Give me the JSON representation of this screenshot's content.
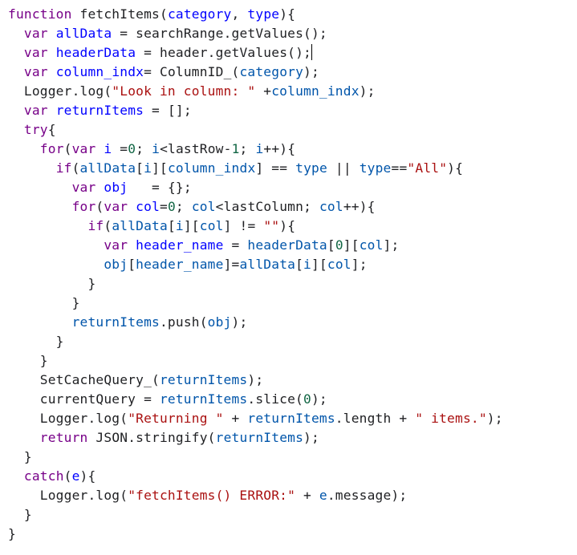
{
  "editor": {
    "language": "javascript",
    "cursor_line": 3,
    "colors": {
      "keyword": "#770088",
      "definition": "#0000ff",
      "variable": "#0055aa",
      "string": "#aa1111",
      "number": "#116644",
      "text": "#202124"
    },
    "lines": [
      [
        [
          "kw",
          "function"
        ],
        [
          "t",
          " fetchItems("
        ],
        [
          "def",
          "category"
        ],
        [
          "t",
          ", "
        ],
        [
          "def",
          "type"
        ],
        [
          "t",
          "){"
        ]
      ],
      [
        [
          "t",
          "  "
        ],
        [
          "kw",
          "var"
        ],
        [
          "t",
          " "
        ],
        [
          "def",
          "allData"
        ],
        [
          "t",
          " = searchRange.getValues();"
        ]
      ],
      [
        [
          "t",
          "  "
        ],
        [
          "kw",
          "var"
        ],
        [
          "t",
          " "
        ],
        [
          "def",
          "headerData"
        ],
        [
          "t",
          " = header.getValues();"
        ]
      ],
      [
        [
          "t",
          "  "
        ],
        [
          "kw",
          "var"
        ],
        [
          "t",
          " "
        ],
        [
          "def",
          "column_indx"
        ],
        [
          "t",
          "= ColumnID_("
        ],
        [
          "var",
          "category"
        ],
        [
          "t",
          ");"
        ]
      ],
      [
        [
          "t",
          "  Logger.log("
        ],
        [
          "str",
          "\"Look in column: \""
        ],
        [
          "t",
          " +"
        ],
        [
          "var",
          "column_indx"
        ],
        [
          "t",
          ");"
        ]
      ],
      [
        [
          "t",
          "  "
        ],
        [
          "kw",
          "var"
        ],
        [
          "t",
          " "
        ],
        [
          "def",
          "returnItems"
        ],
        [
          "t",
          " = [];"
        ]
      ],
      [
        [
          "t",
          "  "
        ],
        [
          "kw",
          "try"
        ],
        [
          "t",
          "{"
        ]
      ],
      [
        [
          "t",
          "    "
        ],
        [
          "kw",
          "for"
        ],
        [
          "t",
          "("
        ],
        [
          "kw",
          "var"
        ],
        [
          "t",
          " "
        ],
        [
          "def",
          "i"
        ],
        [
          "t",
          " ="
        ],
        [
          "num",
          "0"
        ],
        [
          "t",
          "; "
        ],
        [
          "var",
          "i"
        ],
        [
          "t",
          "<lastRow-"
        ],
        [
          "num",
          "1"
        ],
        [
          "t",
          "; "
        ],
        [
          "var",
          "i"
        ],
        [
          "t",
          "++){"
        ]
      ],
      [
        [
          "t",
          "      "
        ],
        [
          "kw",
          "if"
        ],
        [
          "t",
          "("
        ],
        [
          "var",
          "allData"
        ],
        [
          "t",
          "["
        ],
        [
          "var",
          "i"
        ],
        [
          "t",
          "]["
        ],
        [
          "var",
          "column_indx"
        ],
        [
          "t",
          "] == "
        ],
        [
          "var",
          "type"
        ],
        [
          "t",
          " || "
        ],
        [
          "var",
          "type"
        ],
        [
          "t",
          "=="
        ],
        [
          "str",
          "\"All\""
        ],
        [
          "t",
          "){"
        ]
      ],
      [
        [
          "t",
          "        "
        ],
        [
          "kw",
          "var"
        ],
        [
          "t",
          " "
        ],
        [
          "def",
          "obj"
        ],
        [
          "t",
          "   = {};"
        ]
      ],
      [
        [
          "t",
          "        "
        ],
        [
          "kw",
          "for"
        ],
        [
          "t",
          "("
        ],
        [
          "kw",
          "var"
        ],
        [
          "t",
          " "
        ],
        [
          "def",
          "col"
        ],
        [
          "t",
          "="
        ],
        [
          "num",
          "0"
        ],
        [
          "t",
          "; "
        ],
        [
          "var",
          "col"
        ],
        [
          "t",
          "<lastColumn; "
        ],
        [
          "var",
          "col"
        ],
        [
          "t",
          "++){"
        ]
      ],
      [
        [
          "t",
          "          "
        ],
        [
          "kw",
          "if"
        ],
        [
          "t",
          "("
        ],
        [
          "var",
          "allData"
        ],
        [
          "t",
          "["
        ],
        [
          "var",
          "i"
        ],
        [
          "t",
          "]["
        ],
        [
          "var",
          "col"
        ],
        [
          "t",
          "] != "
        ],
        [
          "str",
          "\"\""
        ],
        [
          "t",
          "){"
        ]
      ],
      [
        [
          "t",
          "            "
        ],
        [
          "kw",
          "var"
        ],
        [
          "t",
          " "
        ],
        [
          "def",
          "header_name"
        ],
        [
          "t",
          " = "
        ],
        [
          "var",
          "headerData"
        ],
        [
          "t",
          "["
        ],
        [
          "num",
          "0"
        ],
        [
          "t",
          "]["
        ],
        [
          "var",
          "col"
        ],
        [
          "t",
          "];"
        ]
      ],
      [
        [
          "t",
          "            "
        ],
        [
          "var",
          "obj"
        ],
        [
          "t",
          "["
        ],
        [
          "var",
          "header_name"
        ],
        [
          "t",
          "]="
        ],
        [
          "var",
          "allData"
        ],
        [
          "t",
          "["
        ],
        [
          "var",
          "i"
        ],
        [
          "t",
          "]["
        ],
        [
          "var",
          "col"
        ],
        [
          "t",
          "];"
        ]
      ],
      [
        [
          "t",
          "          }"
        ]
      ],
      [
        [
          "t",
          "        }"
        ]
      ],
      [
        [
          "t",
          "        "
        ],
        [
          "var",
          "returnItems"
        ],
        [
          "t",
          ".push("
        ],
        [
          "var",
          "obj"
        ],
        [
          "t",
          ");"
        ]
      ],
      [
        [
          "t",
          "      }"
        ]
      ],
      [
        [
          "t",
          "    }"
        ]
      ],
      [
        [
          "t",
          "    SetCacheQuery_("
        ],
        [
          "var",
          "returnItems"
        ],
        [
          "t",
          ");"
        ]
      ],
      [
        [
          "t",
          "    currentQuery = "
        ],
        [
          "var",
          "returnItems"
        ],
        [
          "t",
          ".slice("
        ],
        [
          "num",
          "0"
        ],
        [
          "t",
          ");"
        ]
      ],
      [
        [
          "t",
          "    Logger.log("
        ],
        [
          "str",
          "\"Returning \""
        ],
        [
          "t",
          " + "
        ],
        [
          "var",
          "returnItems"
        ],
        [
          "t",
          ".length + "
        ],
        [
          "str",
          "\" items.\""
        ],
        [
          "t",
          ");"
        ]
      ],
      [
        [
          "t",
          "    "
        ],
        [
          "kw",
          "return"
        ],
        [
          "t",
          " JSON.stringify("
        ],
        [
          "var",
          "returnItems"
        ],
        [
          "t",
          ");"
        ]
      ],
      [
        [
          "t",
          "  }"
        ]
      ],
      [
        [
          "t",
          "  "
        ],
        [
          "kw",
          "catch"
        ],
        [
          "t",
          "("
        ],
        [
          "def",
          "e"
        ],
        [
          "t",
          "){"
        ]
      ],
      [
        [
          "t",
          "    Logger.log("
        ],
        [
          "str",
          "\"fetchItems() ERROR:\""
        ],
        [
          "t",
          " + "
        ],
        [
          "var",
          "e"
        ],
        [
          "t",
          ".message);"
        ]
      ],
      [
        [
          "t",
          "  }"
        ]
      ],
      [
        [
          "t",
          "}"
        ]
      ]
    ]
  }
}
